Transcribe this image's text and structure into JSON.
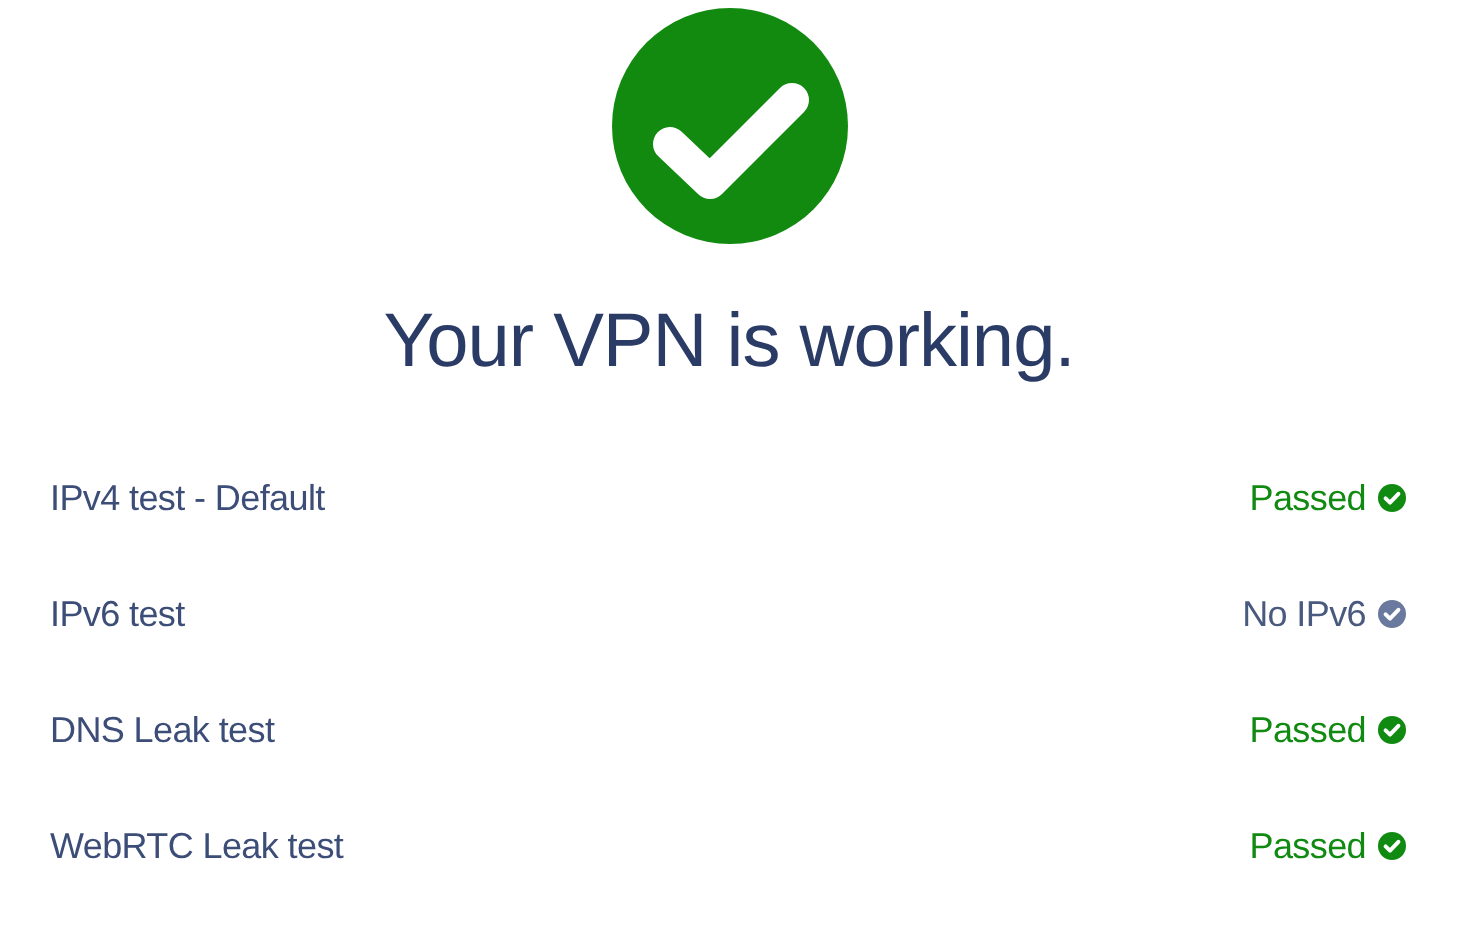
{
  "heading": "Your VPN is working.",
  "tests": [
    {
      "name": "IPv4 test - Default",
      "result": "Passed",
      "kind": "pass"
    },
    {
      "name": "IPv6 test",
      "result": "No IPv6",
      "kind": "info"
    },
    {
      "name": "DNS Leak test",
      "result": "Passed",
      "kind": "pass"
    },
    {
      "name": "WebRTC Leak test",
      "result": "Passed",
      "kind": "pass"
    }
  ]
}
